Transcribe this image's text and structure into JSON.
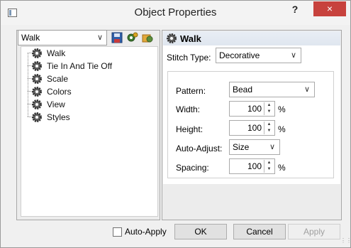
{
  "window": {
    "title": "Object Properties",
    "help_label": "?",
    "close_label": "×"
  },
  "left": {
    "object_selector": "Walk",
    "tree": [
      {
        "label": "Walk"
      },
      {
        "label": "Tie In And Tie Off"
      },
      {
        "label": "Scale"
      },
      {
        "label": "Colors"
      },
      {
        "label": "View"
      },
      {
        "label": "Styles"
      }
    ]
  },
  "right": {
    "header": "Walk",
    "stitch_type_label": "Stitch Type:",
    "stitch_type_value": "Decorative",
    "fields": {
      "pattern_label": "Pattern:",
      "pattern_value": "Bead",
      "width_label": "Width:",
      "width_value": "100",
      "width_unit": "%",
      "height_label": "Height:",
      "height_value": "100",
      "height_unit": "%",
      "auto_adjust_label": "Auto-Adjust:",
      "auto_adjust_value": "Size",
      "spacing_label": "Spacing:",
      "spacing_value": "100",
      "spacing_unit": "%"
    }
  },
  "footer": {
    "auto_apply_label": "Auto-Apply",
    "ok_label": "OK",
    "cancel_label": "Cancel",
    "apply_label": "Apply"
  },
  "colors": {
    "close_button": "#c7423d",
    "header_bg": "#e3e9f1"
  }
}
